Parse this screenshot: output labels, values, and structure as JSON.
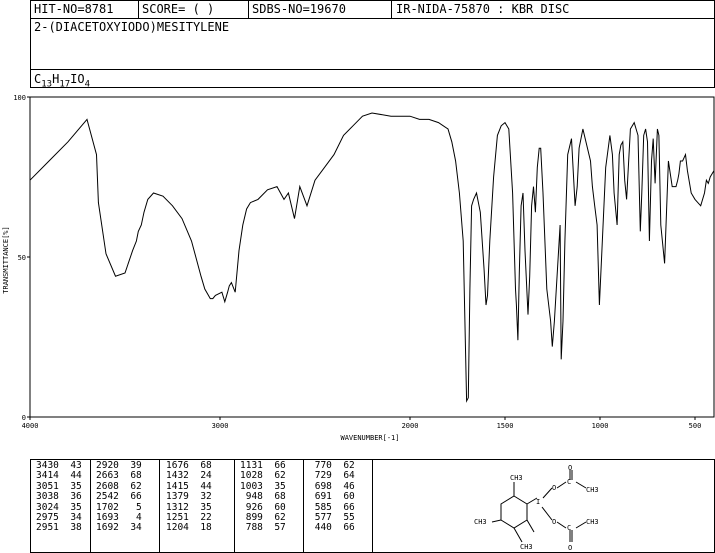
{
  "header": {
    "hit_no": "HIT-NO=8781",
    "score": "SCORE=  (   )",
    "sdbs_no": "SDBS-NO=19670",
    "ir_info": "IR-NIDA-75870 : KBR DISC"
  },
  "compound_name": "2-(DIACETOXYIODO)MESITYLENE",
  "formula": {
    "c": "C",
    "c_n": "13",
    "h": "H",
    "h_n": "17",
    "i": "I",
    "o": "O",
    "o_n": "4"
  },
  "chart_data": {
    "type": "line",
    "title": "",
    "xlabel": "WAVENUMBER[-1]",
    "ylabel": "TRANSMITTANCE[%]",
    "xlim": [
      4000,
      400
    ],
    "ylim": [
      0,
      100
    ],
    "x_ticks": [
      4000,
      3000,
      2000,
      1500,
      1000,
      500
    ],
    "y_ticks": [
      0,
      50,
      100
    ],
    "grid": false,
    "legend": "none",
    "line_color": "#000000",
    "series": [
      {
        "x": [
          4000,
          3900,
          3800,
          3700,
          3650,
          3640,
          3600,
          3550,
          3500,
          3460,
          3440,
          3430,
          3414,
          3400,
          3380,
          3350,
          3300,
          3250,
          3200,
          3150,
          3100,
          3080,
          3051,
          3038,
          3024,
          2990,
          2975,
          2960,
          2951,
          2940,
          2920,
          2900,
          2880,
          2860,
          2840,
          2800,
          2750,
          2700,
          2663,
          2640,
          2608,
          2580,
          2542,
          2500,
          2450,
          2400,
          2350,
          2300,
          2250,
          2200,
          2100,
          2000,
          1950,
          1900,
          1850,
          1800,
          1780,
          1760,
          1740,
          1720,
          1702,
          1693,
          1685,
          1676,
          1665,
          1650,
          1630,
          1610,
          1600,
          1592,
          1580,
          1560,
          1540,
          1520,
          1500,
          1480,
          1460,
          1445,
          1440,
          1432,
          1425,
          1415,
          1405,
          1395,
          1379,
          1370,
          1360,
          1350,
          1340,
          1330,
          1320,
          1312,
          1300,
          1280,
          1260,
          1251,
          1240,
          1220,
          1210,
          1204,
          1195,
          1185,
          1170,
          1150,
          1131,
          1120,
          1110,
          1090,
          1070,
          1050,
          1040,
          1028,
          1015,
          1003,
          990,
          970,
          948,
          935,
          926,
          910,
          899,
          890,
          880,
          870,
          860,
          840,
          820,
          800,
          788,
          780,
          770,
          760,
          750,
          740,
          729,
          720,
          710,
          698,
          690,
          680,
          660,
          640,
          620,
          600,
          591,
          585,
          577,
          565,
          550,
          540,
          520,
          500,
          470,
          450,
          440,
          430,
          420,
          410,
          400
        ],
        "y": [
          74,
          80,
          86,
          93,
          82,
          67,
          51,
          44,
          45,
          52,
          55,
          58,
          60,
          64,
          68,
          70,
          69,
          66,
          62,
          55,
          44,
          40,
          37,
          37,
          38,
          39,
          36,
          39,
          41,
          42,
          39,
          52,
          60,
          65,
          67,
          68,
          71,
          72,
          68,
          70,
          62,
          72,
          66,
          74,
          78,
          82,
          88,
          91,
          94,
          95,
          94,
          94,
          93,
          93,
          92,
          90,
          86,
          80,
          70,
          55,
          5,
          6,
          40,
          66,
          68,
          70,
          64,
          46,
          35,
          38,
          55,
          75,
          88,
          91,
          92,
          90,
          70,
          40,
          35,
          24,
          45,
          66,
          70,
          52,
          32,
          44,
          66,
          72,
          64,
          78,
          84,
          84,
          70,
          40,
          30,
          22,
          30,
          50,
          60,
          18,
          30,
          55,
          82,
          87,
          66,
          72,
          84,
          90,
          85,
          80,
          72,
          66,
          60,
          35,
          52,
          78,
          88,
          82,
          70,
          60,
          82,
          85,
          86,
          74,
          68,
          90,
          92,
          88,
          58,
          70,
          88,
          90,
          86,
          55,
          80,
          87,
          73,
          90,
          88,
          60,
          48,
          80,
          72,
          72,
          74,
          76,
          80,
          80,
          82,
          77,
          70,
          68,
          66,
          70,
          74,
          73,
          75,
          76,
          77
        ]
      }
    ],
    "peak_table": [
      [
        [
          3430,
          43
        ],
        [
          3414,
          44
        ],
        [
          3051,
          35
        ],
        [
          3038,
          36
        ],
        [
          3024,
          35
        ],
        [
          2975,
          34
        ],
        [
          2951,
          38
        ]
      ],
      [
        [
          2920,
          39
        ],
        [
          2663,
          68
        ],
        [
          2608,
          62
        ],
        [
          2542,
          66
        ],
        [
          1702,
          5
        ],
        [
          1693,
          4
        ],
        [
          1692,
          34
        ]
      ],
      [
        [
          1676,
          68
        ],
        [
          1432,
          24
        ],
        [
          1415,
          44
        ],
        [
          1379,
          32
        ],
        [
          1312,
          35
        ],
        [
          1251,
          22
        ],
        [
          1204,
          18
        ]
      ],
      [
        [
          1131,
          66
        ],
        [
          1028,
          62
        ],
        [
          1003,
          35
        ],
        [
          948,
          68
        ],
        [
          926,
          60
        ],
        [
          899,
          62
        ],
        [
          788,
          57
        ]
      ],
      [
        [
          770,
          62
        ],
        [
          729,
          64
        ],
        [
          698,
          46
        ],
        [
          691,
          60
        ],
        [
          585,
          66
        ],
        [
          577,
          55
        ],
        [
          440,
          66
        ]
      ]
    ]
  },
  "structure": {
    "labels": [
      "CH3",
      "CH3",
      "CH3",
      "I",
      "O",
      "O",
      "O",
      "O",
      "C",
      "C",
      "CH3",
      "CH3"
    ]
  }
}
